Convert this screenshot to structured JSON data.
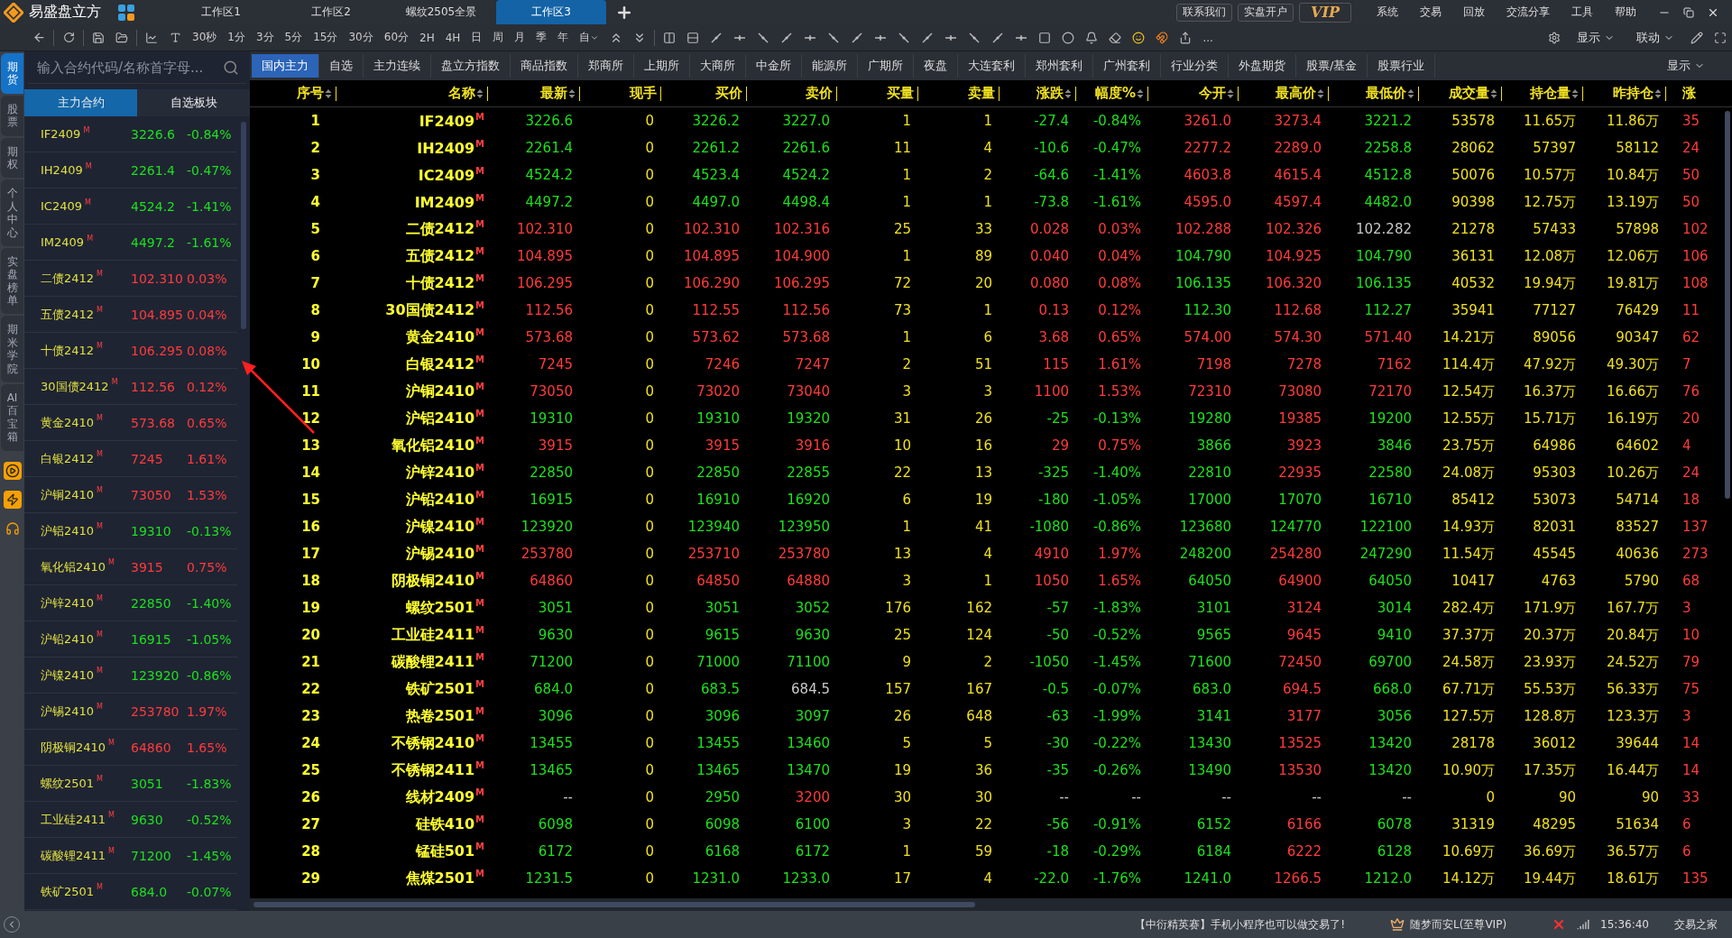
{
  "title_bar": {
    "app_name": "易盛盘立方",
    "workspaces": [
      {
        "label": "工作区1",
        "selected": false
      },
      {
        "label": "工作区2",
        "selected": false
      },
      {
        "label": "螺纹2505全景",
        "selected": false
      },
      {
        "label": "工作区3",
        "selected": true
      }
    ],
    "links": [
      "联系我们",
      "实盘开户"
    ],
    "vip": "VIP",
    "menu": [
      "系统",
      "交易",
      "回放",
      "交流分享",
      "工具",
      "帮助"
    ]
  },
  "toolbar": {
    "periods": [
      "30秒",
      "1分",
      "3分",
      "5分",
      "15分",
      "30分",
      "60分",
      "2H",
      "4H",
      "日",
      "周",
      "月",
      "季",
      "年",
      "自"
    ],
    "more": "...",
    "dropdowns": [
      "显示",
      "联动"
    ]
  },
  "side_tabs": [
    {
      "label": "期货",
      "selected": true
    },
    {
      "label": "股票",
      "selected": false
    },
    {
      "label": "期权",
      "selected": false
    },
    {
      "label": "个人中心",
      "selected": false
    },
    {
      "label": "实盘榜单",
      "selected": false
    },
    {
      "label": "期米学院",
      "selected": false
    },
    {
      "label": "AI百宝箱",
      "selected": false
    }
  ],
  "sidebar": {
    "search": {
      "placeholder": "输入合约代码/名称首字母..."
    },
    "tabs": [
      {
        "label": "主力合约",
        "selected": true
      },
      {
        "label": "自选板块",
        "selected": false
      }
    ],
    "items": [
      {
        "name": "IF2409",
        "tag": "M",
        "price": "3226.6",
        "change": "-0.84%",
        "color": "#1ee01e"
      },
      {
        "name": "IH2409",
        "tag": "M",
        "price": "2261.4",
        "change": "-0.47%",
        "color": "#1ee01e"
      },
      {
        "name": "IC2409",
        "tag": "M",
        "price": "4524.2",
        "change": "-1.41%",
        "color": "#1ee01e"
      },
      {
        "name": "IM2409",
        "tag": "M",
        "price": "4497.2",
        "change": "-1.61%",
        "color": "#1ee01e"
      },
      {
        "name": "二债2412",
        "tag": "M",
        "price": "102.310",
        "change": "0.03%",
        "color": "#ff3b3b"
      },
      {
        "name": "五债2412",
        "tag": "M",
        "price": "104.895",
        "change": "0.04%",
        "color": "#ff3b3b"
      },
      {
        "name": "十债2412",
        "tag": "M",
        "price": "106.295",
        "change": "0.08%",
        "color": "#ff3b3b"
      },
      {
        "name": "30国债2412",
        "tag": "M",
        "price": "112.56",
        "change": "0.12%",
        "color": "#ff3b3b"
      },
      {
        "name": "黄金2410",
        "tag": "M",
        "price": "573.68",
        "change": "0.65%",
        "color": "#ff3b3b"
      },
      {
        "name": "白银2412",
        "tag": "M",
        "price": "7245",
        "change": "1.61%",
        "color": "#ff3b3b"
      },
      {
        "name": "沪铜2410",
        "tag": "M",
        "price": "73050",
        "change": "1.53%",
        "color": "#ff3b3b"
      },
      {
        "name": "沪铝2410",
        "tag": "M",
        "price": "19310",
        "change": "-0.13%",
        "color": "#1ee01e"
      },
      {
        "name": "氧化铝2410",
        "tag": "M",
        "price": "3915",
        "change": "0.75%",
        "color": "#ff3b3b"
      },
      {
        "name": "沪锌2410",
        "tag": "M",
        "price": "22850",
        "change": "-1.40%",
        "color": "#1ee01e"
      },
      {
        "name": "沪铅2410",
        "tag": "M",
        "price": "16915",
        "change": "-1.05%",
        "color": "#1ee01e"
      },
      {
        "name": "沪镍2410",
        "tag": "M",
        "price": "123920",
        "change": "-0.86%",
        "color": "#1ee01e"
      },
      {
        "name": "沪锡2410",
        "tag": "M",
        "price": "253780",
        "change": "1.97%",
        "color": "#ff3b3b"
      },
      {
        "name": "阴极铜2410",
        "tag": "M",
        "price": "64860",
        "change": "1.65%",
        "color": "#ff3b3b"
      },
      {
        "name": "螺纹2501",
        "tag": "M",
        "price": "3051",
        "change": "-1.83%",
        "color": "#1ee01e"
      },
      {
        "name": "工业硅2411",
        "tag": "M",
        "price": "9630",
        "change": "-0.52%",
        "color": "#1ee01e"
      },
      {
        "name": "碳酸锂2411",
        "tag": "M",
        "price": "71200",
        "change": "-1.45%",
        "color": "#1ee01e"
      },
      {
        "name": "铁矿2501",
        "tag": "M",
        "price": "684.0",
        "change": "-0.07%",
        "color": "#1ee01e"
      }
    ]
  },
  "market_tabs": [
    {
      "label": "国内主力",
      "selected": true
    },
    {
      "label": "自选",
      "selected": false
    },
    {
      "label": "主力连续",
      "selected": false
    },
    {
      "label": "盘立方指数",
      "selected": false
    },
    {
      "label": "商品指数",
      "selected": false
    },
    {
      "label": "郑商所",
      "selected": false
    },
    {
      "label": "上期所",
      "selected": false
    },
    {
      "label": "大商所",
      "selected": false
    },
    {
      "label": "中金所",
      "selected": false
    },
    {
      "label": "能源所",
      "selected": false
    },
    {
      "label": "广期所",
      "selected": false
    },
    {
      "label": "夜盘",
      "selected": false
    },
    {
      "label": "大连套利",
      "selected": false
    },
    {
      "label": "郑州套利",
      "selected": false
    },
    {
      "label": "广州套利",
      "selected": false
    },
    {
      "label": "行业分类",
      "selected": false
    },
    {
      "label": "外盘期货",
      "selected": false
    },
    {
      "label": "股票/基金",
      "selected": false
    },
    {
      "label": "股票行业",
      "selected": false
    }
  ],
  "display_menu": "显示",
  "table": {
    "columns": [
      {
        "label": "序号",
        "sortable": true
      },
      {
        "label": "名称",
        "sortable": true
      },
      {
        "label": "最新",
        "sortable": true
      },
      {
        "label": "现手",
        "sortable": false
      },
      {
        "label": "买价",
        "sortable": false
      },
      {
        "label": "卖价",
        "sortable": false
      },
      {
        "label": "买量",
        "sortable": false
      },
      {
        "label": "卖量",
        "sortable": false
      },
      {
        "label": "涨跌",
        "sortable": true
      },
      {
        "label": "幅度%",
        "sortable": true
      },
      {
        "label": "今开",
        "sortable": true
      },
      {
        "label": "最高价",
        "sortable": true
      },
      {
        "label": "最低价",
        "sortable": true
      },
      {
        "label": "成交量",
        "sortable": true
      },
      {
        "label": "持仓量",
        "sortable": true
      },
      {
        "label": "昨持仓",
        "sortable": true
      },
      {
        "label": "涨",
        "sortable": false
      }
    ],
    "rows": [
      {
        "cells": [
          "1",
          "IF2409",
          {
            "text": "3226.6",
            "color": "#1ee01e"
          },
          "0",
          {
            "text": "3226.2",
            "color": "#1ee01e"
          },
          {
            "text": "3227.0",
            "color": "#1ee01e"
          },
          "1",
          "1",
          {
            "text": "-27.4",
            "color": "#1ee01e"
          },
          {
            "text": "-0.84%",
            "color": "#1ee01e"
          },
          {
            "text": "3261.0",
            "color": "#ff3b3b"
          },
          {
            "text": "3273.4",
            "color": "#ff3b3b"
          },
          {
            "text": "3221.2",
            "color": "#1ee01e"
          },
          "53578",
          "11.65万",
          "11.86万",
          {
            "text": "35",
            "color": "#ff3b3b"
          }
        ],
        "tag": "M"
      },
      {
        "cells": [
          "2",
          "IH2409",
          {
            "text": "2261.4",
            "color": "#1ee01e"
          },
          "0",
          {
            "text": "2261.2",
            "color": "#1ee01e"
          },
          {
            "text": "2261.6",
            "color": "#1ee01e"
          },
          "11",
          "4",
          {
            "text": "-10.6",
            "color": "#1ee01e"
          },
          {
            "text": "-0.47%",
            "color": "#1ee01e"
          },
          {
            "text": "2277.2",
            "color": "#ff3b3b"
          },
          {
            "text": "2289.0",
            "color": "#ff3b3b"
          },
          {
            "text": "2258.8",
            "color": "#1ee01e"
          },
          "28062",
          "57397",
          "58112",
          {
            "text": "24",
            "color": "#ff3b3b"
          }
        ],
        "tag": "M"
      },
      {
        "cells": [
          "3",
          "IC2409",
          {
            "text": "4524.2",
            "color": "#1ee01e"
          },
          "0",
          {
            "text": "4523.4",
            "color": "#1ee01e"
          },
          {
            "text": "4524.2",
            "color": "#1ee01e"
          },
          "1",
          "2",
          {
            "text": "-64.6",
            "color": "#1ee01e"
          },
          {
            "text": "-1.41%",
            "color": "#1ee01e"
          },
          {
            "text": "4603.8",
            "color": "#ff3b3b"
          },
          {
            "text": "4615.4",
            "color": "#ff3b3b"
          },
          {
            "text": "4512.8",
            "color": "#1ee01e"
          },
          "50076",
          "10.57万",
          "10.84万",
          {
            "text": "50",
            "color": "#ff3b3b"
          }
        ],
        "tag": "M"
      },
      {
        "cells": [
          "4",
          "IM2409",
          {
            "text": "4497.2",
            "color": "#1ee01e"
          },
          "0",
          {
            "text": "4497.0",
            "color": "#1ee01e"
          },
          {
            "text": "4498.4",
            "color": "#1ee01e"
          },
          "1",
          "1",
          {
            "text": "-73.8",
            "color": "#1ee01e"
          },
          {
            "text": "-1.61%",
            "color": "#1ee01e"
          },
          {
            "text": "4595.0",
            "color": "#ff3b3b"
          },
          {
            "text": "4597.4",
            "color": "#ff3b3b"
          },
          {
            "text": "4482.0",
            "color": "#1ee01e"
          },
          "90398",
          "12.75万",
          "13.19万",
          {
            "text": "50",
            "color": "#ff3b3b"
          }
        ],
        "tag": "M"
      },
      {
        "cells": [
          "5",
          "二债2412",
          {
            "text": "102.310",
            "color": "#ff3b3b"
          },
          "0",
          {
            "text": "102.310",
            "color": "#ff3b3b"
          },
          {
            "text": "102.316",
            "color": "#ff3b3b"
          },
          "25",
          "33",
          {
            "text": "0.028",
            "color": "#ff3b3b"
          },
          {
            "text": "0.03%",
            "color": "#ff3b3b"
          },
          {
            "text": "102.288",
            "color": "#ff3b3b"
          },
          {
            "text": "102.326",
            "color": "#ff3b3b"
          },
          {
            "text": "102.282",
            "color": "#c8c8c8"
          },
          "21278",
          "57433",
          "57898",
          {
            "text": "102",
            "color": "#ff3b3b"
          }
        ],
        "tag": "M"
      },
      {
        "cells": [
          "6",
          "五债2412",
          {
            "text": "104.895",
            "color": "#ff3b3b"
          },
          "0",
          {
            "text": "104.895",
            "color": "#ff3b3b"
          },
          {
            "text": "104.900",
            "color": "#ff3b3b"
          },
          "1",
          "89",
          {
            "text": "0.040",
            "color": "#ff3b3b"
          },
          {
            "text": "0.04%",
            "color": "#ff3b3b"
          },
          {
            "text": "104.790",
            "color": "#1ee01e"
          },
          {
            "text": "104.925",
            "color": "#ff3b3b"
          },
          {
            "text": "104.790",
            "color": "#1ee01e"
          },
          "36131",
          "12.08万",
          "12.06万",
          {
            "text": "106",
            "color": "#ff3b3b"
          }
        ],
        "tag": "M"
      },
      {
        "cells": [
          "7",
          "十债2412",
          {
            "text": "106.295",
            "color": "#ff3b3b"
          },
          "0",
          {
            "text": "106.290",
            "color": "#ff3b3b"
          },
          {
            "text": "106.295",
            "color": "#ff3b3b"
          },
          "72",
          "20",
          {
            "text": "0.080",
            "color": "#ff3b3b"
          },
          {
            "text": "0.08%",
            "color": "#ff3b3b"
          },
          {
            "text": "106.135",
            "color": "#1ee01e"
          },
          {
            "text": "106.320",
            "color": "#ff3b3b"
          },
          {
            "text": "106.135",
            "color": "#1ee01e"
          },
          "40532",
          "19.94万",
          "19.81万",
          {
            "text": "108",
            "color": "#ff3b3b"
          }
        ],
        "tag": "M"
      },
      {
        "cells": [
          "8",
          "30国债2412",
          {
            "text": "112.56",
            "color": "#ff3b3b"
          },
          "0",
          {
            "text": "112.55",
            "color": "#ff3b3b"
          },
          {
            "text": "112.56",
            "color": "#ff3b3b"
          },
          "73",
          "1",
          {
            "text": "0.13",
            "color": "#ff3b3b"
          },
          {
            "text": "0.12%",
            "color": "#ff3b3b"
          },
          {
            "text": "112.30",
            "color": "#1ee01e"
          },
          {
            "text": "112.68",
            "color": "#ff3b3b"
          },
          {
            "text": "112.27",
            "color": "#1ee01e"
          },
          "35941",
          "77127",
          "76429",
          {
            "text": "11",
            "color": "#ff3b3b"
          }
        ],
        "tag": "M"
      },
      {
        "cells": [
          "9",
          "黄金2410",
          {
            "text": "573.68",
            "color": "#ff3b3b"
          },
          "0",
          {
            "text": "573.62",
            "color": "#ff3b3b"
          },
          {
            "text": "573.68",
            "color": "#ff3b3b"
          },
          "1",
          "6",
          {
            "text": "3.68",
            "color": "#ff3b3b"
          },
          {
            "text": "0.65%",
            "color": "#ff3b3b"
          },
          {
            "text": "574.00",
            "color": "#ff3b3b"
          },
          {
            "text": "574.30",
            "color": "#ff3b3b"
          },
          {
            "text": "571.40",
            "color": "#ff3b3b"
          },
          "14.21万",
          "89056",
          "90347",
          {
            "text": "62",
            "color": "#ff3b3b"
          }
        ],
        "tag": "M"
      },
      {
        "cells": [
          "10",
          "白银2412",
          {
            "text": "7245",
            "color": "#ff3b3b"
          },
          "0",
          {
            "text": "7246",
            "color": "#ff3b3b"
          },
          {
            "text": "7247",
            "color": "#ff3b3b"
          },
          "2",
          "51",
          {
            "text": "115",
            "color": "#ff3b3b"
          },
          {
            "text": "1.61%",
            "color": "#ff3b3b"
          },
          {
            "text": "7198",
            "color": "#ff3b3b"
          },
          {
            "text": "7278",
            "color": "#ff3b3b"
          },
          {
            "text": "7162",
            "color": "#ff3b3b"
          },
          "114.4万",
          "47.92万",
          "49.30万",
          {
            "text": "7",
            "color": "#ff3b3b"
          }
        ],
        "tag": "M"
      },
      {
        "cells": [
          "11",
          "沪铜2410",
          {
            "text": "73050",
            "color": "#ff3b3b"
          },
          "0",
          {
            "text": "73020",
            "color": "#ff3b3b"
          },
          {
            "text": "73040",
            "color": "#ff3b3b"
          },
          "3",
          "3",
          {
            "text": "1100",
            "color": "#ff3b3b"
          },
          {
            "text": "1.53%",
            "color": "#ff3b3b"
          },
          {
            "text": "72310",
            "color": "#ff3b3b"
          },
          {
            "text": "73080",
            "color": "#ff3b3b"
          },
          {
            "text": "72170",
            "color": "#ff3b3b"
          },
          "12.54万",
          "16.37万",
          "16.66万",
          {
            "text": "76",
            "color": "#ff3b3b"
          }
        ],
        "tag": "M"
      },
      {
        "cells": [
          "12",
          "沪铝2410",
          {
            "text": "19310",
            "color": "#1ee01e"
          },
          "0",
          {
            "text": "19310",
            "color": "#1ee01e"
          },
          {
            "text": "19320",
            "color": "#1ee01e"
          },
          "31",
          "26",
          {
            "text": "-25",
            "color": "#1ee01e"
          },
          {
            "text": "-0.13%",
            "color": "#1ee01e"
          },
          {
            "text": "19280",
            "color": "#1ee01e"
          },
          {
            "text": "19385",
            "color": "#ff3b3b"
          },
          {
            "text": "19200",
            "color": "#1ee01e"
          },
          "12.55万",
          "15.71万",
          "16.19万",
          {
            "text": "20",
            "color": "#ff3b3b"
          }
        ],
        "tag": "M"
      },
      {
        "cells": [
          "13",
          "氧化铝2410",
          {
            "text": "3915",
            "color": "#ff3b3b"
          },
          "0",
          {
            "text": "3915",
            "color": "#ff3b3b"
          },
          {
            "text": "3916",
            "color": "#ff3b3b"
          },
          "10",
          "16",
          {
            "text": "29",
            "color": "#ff3b3b"
          },
          {
            "text": "0.75%",
            "color": "#ff3b3b"
          },
          {
            "text": "3866",
            "color": "#1ee01e"
          },
          {
            "text": "3923",
            "color": "#ff3b3b"
          },
          {
            "text": "3846",
            "color": "#1ee01e"
          },
          "23.75万",
          "64986",
          "64602",
          {
            "text": "4",
            "color": "#ff3b3b"
          }
        ],
        "tag": "M"
      },
      {
        "cells": [
          "14",
          "沪锌2410",
          {
            "text": "22850",
            "color": "#1ee01e"
          },
          "0",
          {
            "text": "22850",
            "color": "#1ee01e"
          },
          {
            "text": "22855",
            "color": "#1ee01e"
          },
          "22",
          "13",
          {
            "text": "-325",
            "color": "#1ee01e"
          },
          {
            "text": "-1.40%",
            "color": "#1ee01e"
          },
          {
            "text": "22810",
            "color": "#1ee01e"
          },
          {
            "text": "22935",
            "color": "#ff3b3b"
          },
          {
            "text": "22580",
            "color": "#1ee01e"
          },
          "24.08万",
          "95303",
          "10.26万",
          {
            "text": "24",
            "color": "#ff3b3b"
          }
        ],
        "tag": "M"
      },
      {
        "cells": [
          "15",
          "沪铅2410",
          {
            "text": "16915",
            "color": "#1ee01e"
          },
          "0",
          {
            "text": "16910",
            "color": "#1ee01e"
          },
          {
            "text": "16920",
            "color": "#1ee01e"
          },
          "6",
          "19",
          {
            "text": "-180",
            "color": "#1ee01e"
          },
          {
            "text": "-1.05%",
            "color": "#1ee01e"
          },
          {
            "text": "17000",
            "color": "#1ee01e"
          },
          {
            "text": "17070",
            "color": "#1ee01e"
          },
          {
            "text": "16710",
            "color": "#1ee01e"
          },
          "85412",
          "53073",
          "54714",
          {
            "text": "18",
            "color": "#ff3b3b"
          }
        ],
        "tag": "M"
      },
      {
        "cells": [
          "16",
          "沪镍2410",
          {
            "text": "123920",
            "color": "#1ee01e"
          },
          "0",
          {
            "text": "123940",
            "color": "#1ee01e"
          },
          {
            "text": "123950",
            "color": "#1ee01e"
          },
          "1",
          "41",
          {
            "text": "-1080",
            "color": "#1ee01e"
          },
          {
            "text": "-0.86%",
            "color": "#1ee01e"
          },
          {
            "text": "123680",
            "color": "#1ee01e"
          },
          {
            "text": "124770",
            "color": "#1ee01e"
          },
          {
            "text": "122100",
            "color": "#1ee01e"
          },
          "14.93万",
          "82031",
          "83527",
          {
            "text": "137",
            "color": "#ff3b3b"
          }
        ],
        "tag": "M"
      },
      {
        "cells": [
          "17",
          "沪锡2410",
          {
            "text": "253780",
            "color": "#ff3b3b"
          },
          "0",
          {
            "text": "253710",
            "color": "#ff3b3b"
          },
          {
            "text": "253780",
            "color": "#ff3b3b"
          },
          "13",
          "4",
          {
            "text": "4910",
            "color": "#ff3b3b"
          },
          {
            "text": "1.97%",
            "color": "#ff3b3b"
          },
          {
            "text": "248200",
            "color": "#1ee01e"
          },
          {
            "text": "254280",
            "color": "#ff3b3b"
          },
          {
            "text": "247290",
            "color": "#1ee01e"
          },
          "11.54万",
          "45545",
          "40636",
          {
            "text": "273",
            "color": "#ff3b3b"
          }
        ],
        "tag": "M"
      },
      {
        "cells": [
          "18",
          "阴极铜2410",
          {
            "text": "64860",
            "color": "#ff3b3b"
          },
          "0",
          {
            "text": "64850",
            "color": "#ff3b3b"
          },
          {
            "text": "64880",
            "color": "#ff3b3b"
          },
          "3",
          "1",
          {
            "text": "1050",
            "color": "#ff3b3b"
          },
          {
            "text": "1.65%",
            "color": "#ff3b3b"
          },
          {
            "text": "64050",
            "color": "#1ee01e"
          },
          {
            "text": "64900",
            "color": "#ff3b3b"
          },
          {
            "text": "64050",
            "color": "#1ee01e"
          },
          "10417",
          "4763",
          "5790",
          {
            "text": "68",
            "color": "#ff3b3b"
          }
        ],
        "tag": "M"
      },
      {
        "cells": [
          "19",
          "螺纹2501",
          {
            "text": "3051",
            "color": "#1ee01e"
          },
          "0",
          {
            "text": "3051",
            "color": "#1ee01e"
          },
          {
            "text": "3052",
            "color": "#1ee01e"
          },
          "176",
          "162",
          {
            "text": "-57",
            "color": "#1ee01e"
          },
          {
            "text": "-1.83%",
            "color": "#1ee01e"
          },
          {
            "text": "3101",
            "color": "#1ee01e"
          },
          {
            "text": "3124",
            "color": "#ff3b3b"
          },
          {
            "text": "3014",
            "color": "#1ee01e"
          },
          "282.4万",
          "171.9万",
          "167.7万",
          {
            "text": "3",
            "color": "#ff3b3b"
          }
        ],
        "tag": "M"
      },
      {
        "cells": [
          "20",
          "工业硅2411",
          {
            "text": "9630",
            "color": "#1ee01e"
          },
          "0",
          {
            "text": "9615",
            "color": "#1ee01e"
          },
          {
            "text": "9630",
            "color": "#1ee01e"
          },
          "25",
          "124",
          {
            "text": "-50",
            "color": "#1ee01e"
          },
          {
            "text": "-0.52%",
            "color": "#1ee01e"
          },
          {
            "text": "9565",
            "color": "#1ee01e"
          },
          {
            "text": "9645",
            "color": "#ff3b3b"
          },
          {
            "text": "9410",
            "color": "#1ee01e"
          },
          "37.37万",
          "20.37万",
          "20.84万",
          {
            "text": "10",
            "color": "#ff3b3b"
          }
        ],
        "tag": "M"
      },
      {
        "cells": [
          "21",
          "碳酸锂2411",
          {
            "text": "71200",
            "color": "#1ee01e"
          },
          "0",
          {
            "text": "71000",
            "color": "#1ee01e"
          },
          {
            "text": "71100",
            "color": "#1ee01e"
          },
          "9",
          "2",
          {
            "text": "-1050",
            "color": "#1ee01e"
          },
          {
            "text": "-1.45%",
            "color": "#1ee01e"
          },
          {
            "text": "71600",
            "color": "#1ee01e"
          },
          {
            "text": "72450",
            "color": "#ff3b3b"
          },
          {
            "text": "69700",
            "color": "#1ee01e"
          },
          "24.58万",
          "23.93万",
          "24.52万",
          {
            "text": "79",
            "color": "#ff3b3b"
          }
        ],
        "tag": "M"
      },
      {
        "cells": [
          "22",
          "铁矿2501",
          {
            "text": "684.0",
            "color": "#1ee01e"
          },
          "0",
          {
            "text": "683.5",
            "color": "#1ee01e"
          },
          {
            "text": "684.5",
            "color": "#c8c8c8"
          },
          "157",
          "167",
          {
            "text": "-0.5",
            "color": "#1ee01e"
          },
          {
            "text": "-0.07%",
            "color": "#1ee01e"
          },
          {
            "text": "683.0",
            "color": "#1ee01e"
          },
          {
            "text": "694.5",
            "color": "#ff3b3b"
          },
          {
            "text": "668.0",
            "color": "#1ee01e"
          },
          "67.71万",
          "55.53万",
          "56.33万",
          {
            "text": "75",
            "color": "#ff3b3b"
          }
        ],
        "tag": "M"
      },
      {
        "cells": [
          "23",
          "热卷2501",
          {
            "text": "3096",
            "color": "#1ee01e"
          },
          "0",
          {
            "text": "3096",
            "color": "#1ee01e"
          },
          {
            "text": "3097",
            "color": "#1ee01e"
          },
          "26",
          "648",
          {
            "text": "-63",
            "color": "#1ee01e"
          },
          {
            "text": "-1.99%",
            "color": "#1ee01e"
          },
          {
            "text": "3141",
            "color": "#1ee01e"
          },
          {
            "text": "3177",
            "color": "#ff3b3b"
          },
          {
            "text": "3056",
            "color": "#1ee01e"
          },
          "127.5万",
          "128.8万",
          "123.3万",
          {
            "text": "3",
            "color": "#ff3b3b"
          }
        ],
        "tag": "M"
      },
      {
        "cells": [
          "24",
          "不锈钢2410",
          {
            "text": "13455",
            "color": "#1ee01e"
          },
          "0",
          {
            "text": "13455",
            "color": "#1ee01e"
          },
          {
            "text": "13460",
            "color": "#1ee01e"
          },
          "5",
          "5",
          {
            "text": "-30",
            "color": "#1ee01e"
          },
          {
            "text": "-0.22%",
            "color": "#1ee01e"
          },
          {
            "text": "13430",
            "color": "#1ee01e"
          },
          {
            "text": "13525",
            "color": "#ff3b3b"
          },
          {
            "text": "13420",
            "color": "#1ee01e"
          },
          "28178",
          "36012",
          "39644",
          {
            "text": "14",
            "color": "#ff3b3b"
          }
        ],
        "tag": "M"
      },
      {
        "cells": [
          "25",
          "不锈钢2411",
          {
            "text": "13465",
            "color": "#1ee01e"
          },
          "0",
          {
            "text": "13465",
            "color": "#1ee01e"
          },
          {
            "text": "13470",
            "color": "#1ee01e"
          },
          "19",
          "36",
          {
            "text": "-35",
            "color": "#1ee01e"
          },
          {
            "text": "-0.26%",
            "color": "#1ee01e"
          },
          {
            "text": "13490",
            "color": "#1ee01e"
          },
          {
            "text": "13530",
            "color": "#ff3b3b"
          },
          {
            "text": "13420",
            "color": "#1ee01e"
          },
          "10.90万",
          "17.35万",
          "16.44万",
          {
            "text": "14",
            "color": "#ff3b3b"
          }
        ],
        "tag": "M"
      },
      {
        "cells": [
          "26",
          "线材2409",
          {
            "text": "--",
            "color": "#c8c8c8"
          },
          "0",
          {
            "text": "2950",
            "color": "#1ee01e"
          },
          {
            "text": "3200",
            "color": "#ff3b3b"
          },
          "30",
          "30",
          {
            "text": "--",
            "color": "#c8c8c8"
          },
          {
            "text": "--",
            "color": "#c8c8c8"
          },
          {
            "text": "--",
            "color": "#c8c8c8"
          },
          {
            "text": "--",
            "color": "#c8c8c8"
          },
          {
            "text": "--",
            "color": "#c8c8c8"
          },
          "0",
          "90",
          "90",
          {
            "text": "33",
            "color": "#ff3b3b"
          }
        ],
        "tag": "M"
      },
      {
        "cells": [
          "27",
          "硅铁410",
          {
            "text": "6098",
            "color": "#1ee01e"
          },
          "0",
          {
            "text": "6098",
            "color": "#1ee01e"
          },
          {
            "text": "6100",
            "color": "#1ee01e"
          },
          "3",
          "22",
          {
            "text": "-56",
            "color": "#1ee01e"
          },
          {
            "text": "-0.91%",
            "color": "#1ee01e"
          },
          {
            "text": "6152",
            "color": "#1ee01e"
          },
          {
            "text": "6166",
            "color": "#ff3b3b"
          },
          {
            "text": "6078",
            "color": "#1ee01e"
          },
          "31319",
          "48295",
          "51634",
          {
            "text": "6",
            "color": "#ff3b3b"
          }
        ],
        "tag": "M"
      },
      {
        "cells": [
          "28",
          "锰硅501",
          {
            "text": "6172",
            "color": "#1ee01e"
          },
          "0",
          {
            "text": "6168",
            "color": "#1ee01e"
          },
          {
            "text": "6172",
            "color": "#1ee01e"
          },
          "1",
          "59",
          {
            "text": "-18",
            "color": "#1ee01e"
          },
          {
            "text": "-0.29%",
            "color": "#1ee01e"
          },
          {
            "text": "6184",
            "color": "#1ee01e"
          },
          {
            "text": "6222",
            "color": "#ff3b3b"
          },
          {
            "text": "6128",
            "color": "#1ee01e"
          },
          "10.69万",
          "36.69万",
          "36.57万",
          {
            "text": "6",
            "color": "#ff3b3b"
          }
        ],
        "tag": "M"
      },
      {
        "cells": [
          "29",
          "焦煤2501",
          {
            "text": "1231.5",
            "color": "#1ee01e"
          },
          "0",
          {
            "text": "1231.0",
            "color": "#1ee01e"
          },
          {
            "text": "1233.0",
            "color": "#1ee01e"
          },
          "17",
          "4",
          {
            "text": "-22.0",
            "color": "#1ee01e"
          },
          {
            "text": "-1.76%",
            "color": "#1ee01e"
          },
          {
            "text": "1241.0",
            "color": "#1ee01e"
          },
          {
            "text": "1266.5",
            "color": "#ff3b3b"
          },
          {
            "text": "1212.0",
            "color": "#1ee01e"
          },
          "14.12万",
          "19.44万",
          "18.61万",
          {
            "text": "135",
            "color": "#ff3b3b"
          }
        ],
        "tag": "M"
      }
    ]
  },
  "status_bar": {
    "notice": "【中衍精英赛】手机小程序也可以做交易了!",
    "user": "随梦而安L(至尊VIP)",
    "time": "15:36:40",
    "site": "交易之家"
  }
}
